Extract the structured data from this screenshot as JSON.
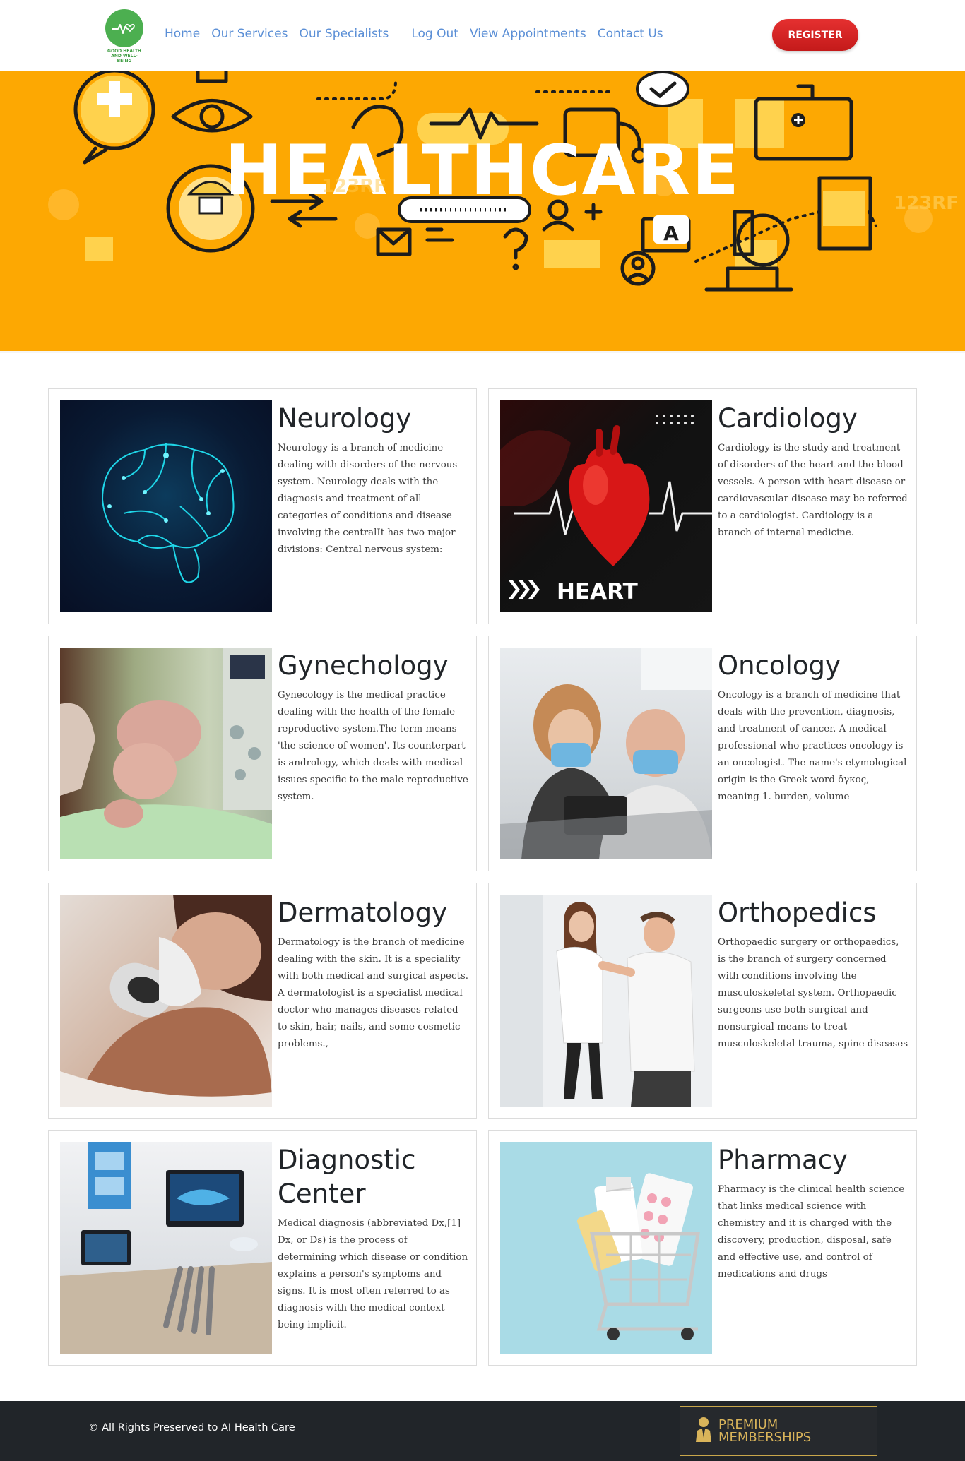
{
  "header": {
    "logo_text_line1": "GOOD HEALTH",
    "logo_text_line2": "AND WELL-BEING",
    "nav": [
      {
        "label": "Home"
      },
      {
        "label": "Our Services"
      },
      {
        "label": "Our Specialists"
      },
      {
        "label": "Log Out"
      },
      {
        "label": "View Appointments"
      },
      {
        "label": "Contact Us"
      }
    ],
    "register_label": "REGISTER"
  },
  "banner": {
    "title": "HEALTHCARE",
    "watermark": "123RF"
  },
  "services": [
    {
      "title": "Neurology",
      "image": "brain-image",
      "text": "Neurology is a branch of medicine dealing with disorders of the nervous system. Neurology deals with the diagnosis and treatment of all categories of conditions and disease involving the centralIt has two major divisions: Central nervous system:"
    },
    {
      "title": "Cardiology",
      "image": "heart-image",
      "image_caption": "HEART",
      "text": "Cardiology is the study and treatment of disorders of the heart and the blood vessels. A person with heart disease or cardiovascular disease may be referred to a cardiologist. Cardiology is a branch of internal medicine."
    },
    {
      "title": "Gynechology",
      "image": "newborn-image",
      "text": "Gynecology is the medical practice dealing with the health of the female reproductive system.The term means 'the science of women'. Its counterpart is andrology, which deals with medical issues specific to the male reproductive system."
    },
    {
      "title": "Oncology",
      "image": "patients-image",
      "text": "Oncology is a branch of medicine that deals with the prevention, diagnosis, and treatment of cancer. A medical professional who practices oncology is an oncologist. The name's etymological origin is the Greek word ὄγκος, meaning 1. burden, volume"
    },
    {
      "title": "Dermatology",
      "image": "skin-exam-image",
      "text": "Dermatology is the branch of medicine dealing with the skin. It is a speciality with both medical and surgical aspects. A dermatologist is a specialist medical doctor who manages diseases related to skin, hair, nails, and some cosmetic problems.,"
    },
    {
      "title": "Orthopedics",
      "image": "shoulder-exam-image",
      "text": "Orthopaedic surgery or orthopaedics, is the branch of surgery concerned with conditions involving the musculoskeletal system. Orthopaedic surgeons use both surgical and nonsurgical means to treat musculoskeletal trauma, spine diseases"
    },
    {
      "title": "Diagnostic Center",
      "image": "dental-room-image",
      "text": "Medical diagnosis (abbreviated Dx,[1] Dx, or Ds) is the process of determining which disease or condition explains a person's symptoms and signs. It is most often referred to as diagnosis with the medical context being implicit."
    },
    {
      "title": "Pharmacy",
      "image": "pills-cart-image",
      "text": "Pharmacy is the clinical health science that links medical science with chemistry and it is charged with the discovery, production, disposal, safe and effective use, and control of medications and drugs"
    }
  ],
  "footer": {
    "copyright": "© All Rights Preserved to AI Health Care",
    "premium_line1": "PREMIUM",
    "premium_line2": "MEMBERSHIPS"
  },
  "colors": {
    "banner": "#fda802",
    "nav_link": "#5b8fd6",
    "register": "#d42424",
    "footer": "#212529",
    "gold": "#d9b45a"
  }
}
